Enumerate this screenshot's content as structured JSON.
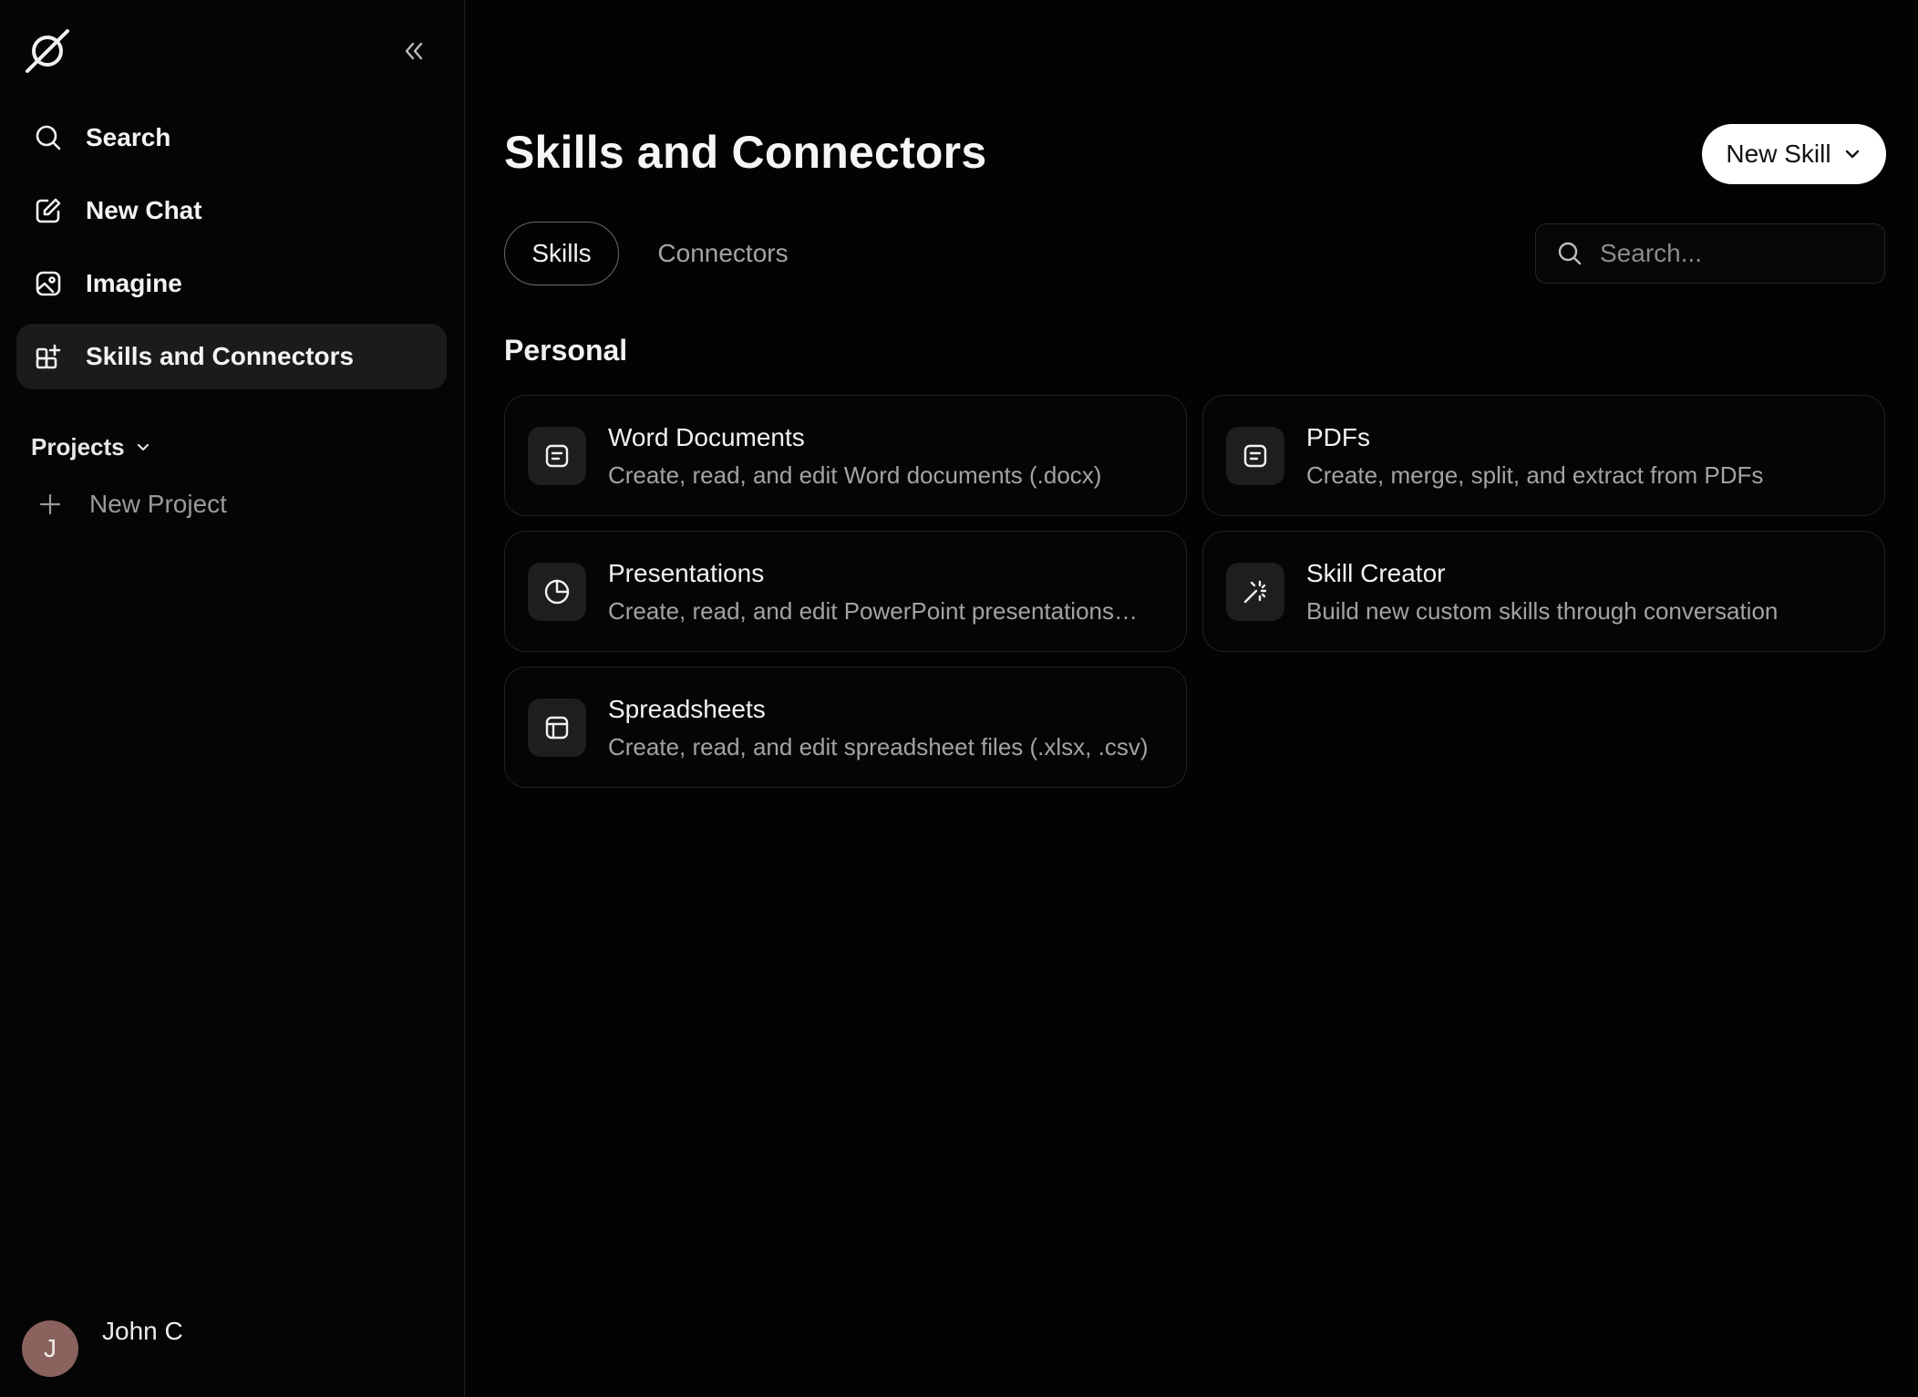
{
  "sidebar": {
    "nav": [
      {
        "label": "Search",
        "icon": "search-icon"
      },
      {
        "label": "New Chat",
        "icon": "edit-icon"
      },
      {
        "label": "Imagine",
        "icon": "image-icon"
      },
      {
        "label": "Skills and Connectors",
        "icon": "grid-plus-icon",
        "active": true
      }
    ],
    "projects_label": "Projects",
    "new_project_label": "New Project",
    "user": {
      "initial": "J",
      "name": "John C",
      "avatar_color": "#8a625e"
    }
  },
  "main": {
    "title": "Skills and Connectors",
    "new_skill_label": "New Skill",
    "tabs": [
      {
        "label": "Skills",
        "active": true
      },
      {
        "label": "Connectors",
        "active": false
      }
    ],
    "search": {
      "placeholder": "Search...",
      "value": ""
    },
    "section_title": "Personal",
    "cards": [
      {
        "title": "Word Documents",
        "description": "Create, read, and edit Word documents (.docx)",
        "icon": "document-icon"
      },
      {
        "title": "PDFs",
        "description": "Create, merge, split, and extract from PDFs",
        "icon": "document-icon"
      },
      {
        "title": "Presentations",
        "description": "Create, read, and edit PowerPoint presentations…",
        "icon": "pie-chart-icon"
      },
      {
        "title": "Skill Creator",
        "description": "Build new custom skills through conversation",
        "icon": "magic-wand-icon"
      },
      {
        "title": "Spreadsheets",
        "description": "Create, read, and edit spreadsheet files (.xlsx, .csv)",
        "icon": "table-icon"
      }
    ]
  },
  "colors": {
    "background": "#030303",
    "active_nav": "#1b1b1b",
    "card_border": "#212121",
    "primary_button": "#ffffff"
  }
}
